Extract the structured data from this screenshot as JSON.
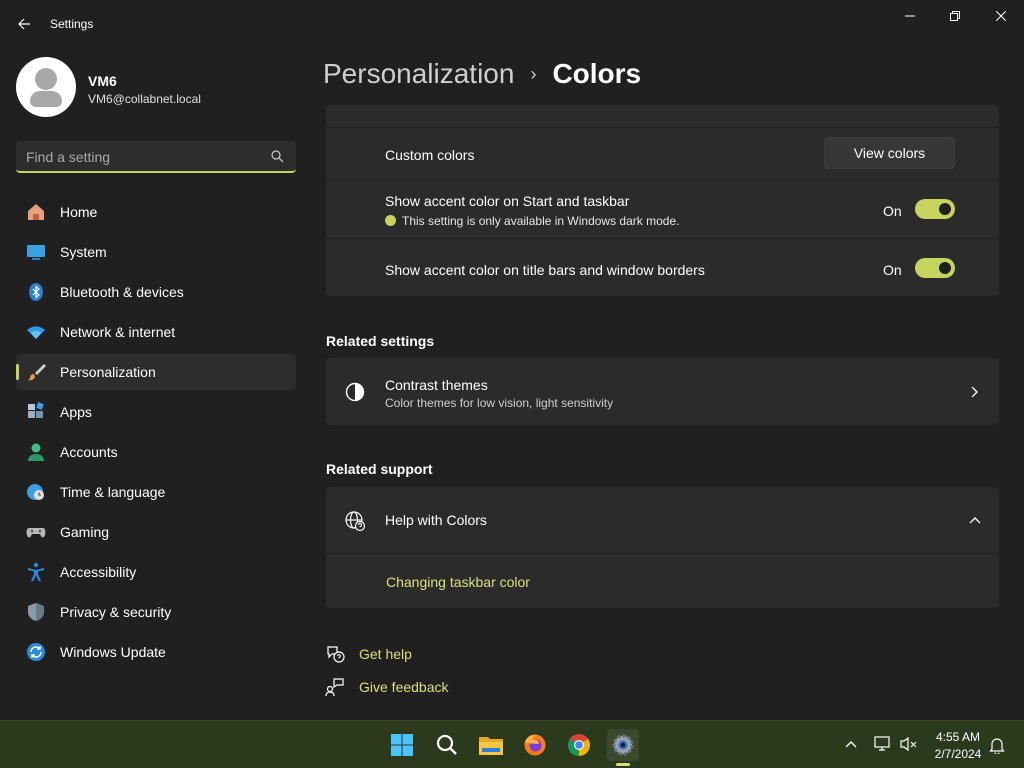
{
  "window": {
    "title": "Settings"
  },
  "profile": {
    "name": "VM6",
    "email": "VM6@collabnet.local"
  },
  "search": {
    "placeholder": "Find a setting"
  },
  "sidebar": {
    "items": [
      {
        "label": "Home",
        "icon": "home-icon"
      },
      {
        "label": "System",
        "icon": "system-icon"
      },
      {
        "label": "Bluetooth & devices",
        "icon": "bluetooth-icon"
      },
      {
        "label": "Network & internet",
        "icon": "wifi-icon"
      },
      {
        "label": "Personalization",
        "icon": "brush-icon",
        "active": true
      },
      {
        "label": "Apps",
        "icon": "apps-icon"
      },
      {
        "label": "Accounts",
        "icon": "accounts-icon"
      },
      {
        "label": "Time & language",
        "icon": "globe-clock-icon"
      },
      {
        "label": "Gaming",
        "icon": "gamepad-icon"
      },
      {
        "label": "Accessibility",
        "icon": "accessibility-icon"
      },
      {
        "label": "Privacy & security",
        "icon": "shield-icon"
      },
      {
        "label": "Windows Update",
        "icon": "update-icon"
      }
    ]
  },
  "breadcrumb": {
    "parent": "Personalization",
    "separator": "›",
    "current": "Colors"
  },
  "colors": {
    "custom_colors_label": "Custom colors",
    "view_colors_button": "View colors",
    "accent_start_label": "Show accent color on Start and taskbar",
    "accent_start_note": "This setting is only available in Windows dark mode.",
    "accent_start_state": "On",
    "accent_titlebar_label": "Show accent color on title bars and window borders",
    "accent_titlebar_state": "On"
  },
  "related_settings": {
    "title": "Related settings",
    "contrast_title": "Contrast themes",
    "contrast_sub": "Color themes for low vision, light sensitivity"
  },
  "related_support": {
    "title": "Related support",
    "help_title": "Help with Colors",
    "link": "Changing taskbar color"
  },
  "footer_links": {
    "get_help": "Get help",
    "give_feedback": "Give feedback"
  },
  "taskbar": {
    "time": "4:55 AM",
    "date": "2/7/2024"
  },
  "accent_color": "#c5d45f"
}
